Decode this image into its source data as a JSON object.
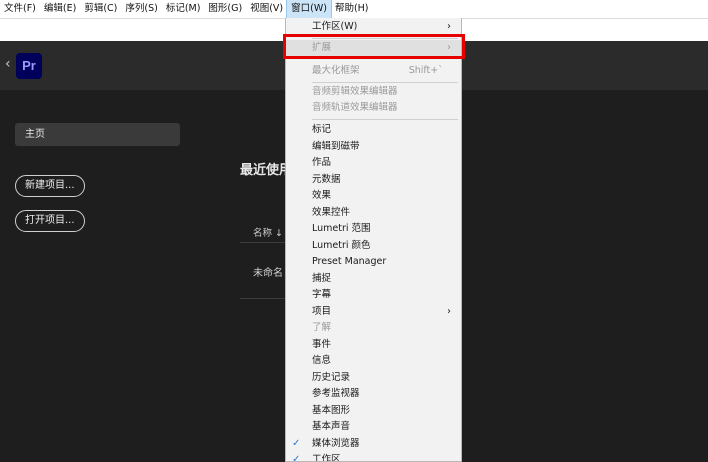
{
  "menubar": [
    "文件(F)",
    "编辑(E)",
    "剪辑(C)",
    "序列(S)",
    "标记(M)",
    "图形(G)",
    "视图(V)",
    "窗口(W)",
    "帮助(H)"
  ],
  "app": {
    "logo": "Pr",
    "back_icon": "chevron-left-icon"
  },
  "sidebar": {
    "home": "主页",
    "new_project": "新建项目...",
    "open_project": "打开项目..."
  },
  "main": {
    "recent_title": "最近使用",
    "col_name": "名称",
    "sort_icon": "arrow-down-icon",
    "row1": "未命名"
  },
  "dropdown": {
    "workspace": "工作区(W)",
    "extensions": "扩展",
    "maximize": "最大化框架",
    "maximize_shortcut": "Shift+`",
    "audio_clip_effect_editor": "音频剪辑效果编辑器",
    "audio_track_effect_editor": "音频轨道效果编辑器",
    "markers": "标记",
    "edit_to_tape": "编辑到磁带",
    "works": "作品",
    "metadata": "元数据",
    "effects": "效果",
    "effect_controls": "效果控件",
    "lumetri_scopes": "Lumetri 范围",
    "lumetri_color": "Lumetri 颜色",
    "preset_manager": "Preset Manager",
    "capture": "捕捉",
    "captions": "字幕",
    "project": "项目",
    "learn": "了解",
    "events": "事件",
    "info": "信息",
    "history": "历史记录",
    "reference_monitor": "参考监视器",
    "essential_graphics": "基本图形",
    "essential_sound": "基本声音",
    "media_browser": "媒体浏览器",
    "workspaces": "工作区"
  }
}
